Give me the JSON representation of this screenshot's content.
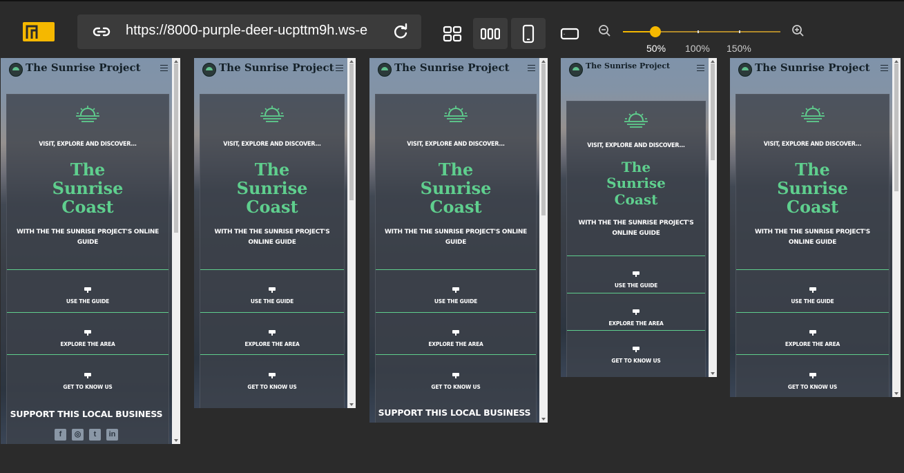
{
  "toolbar": {
    "url": "https://8000-purple-deer-ucpttm9h.ws-e",
    "zoom_options": [
      "50%",
      "100%",
      "150%"
    ],
    "zoom_selected": "50%",
    "view_icons": [
      "grid-view-icon",
      "columns-view-icon",
      "phone-icon",
      "tablet-landscape-icon"
    ],
    "accent": "#f5b800"
  },
  "site": {
    "brand": "The Sunrise Project",
    "tagline": "VISIT, EXPLORE AND DISCOVER...",
    "title_lines": [
      "The",
      "Sunrise",
      "Coast"
    ],
    "subtitle": "WITH THE THE SUNRISE PROJECT'S ONLINE GUIDE",
    "nav_items": [
      "USE THE GUIDE",
      "EXPLORE THE AREA",
      "GET TO KNOW US"
    ],
    "support": "SUPPORT THIS LOCAL BUSINESS",
    "socials": [
      "facebook-icon",
      "instagram-icon",
      "twitter-icon",
      "linkedin-icon"
    ],
    "title_color": "#5fcf8e"
  }
}
